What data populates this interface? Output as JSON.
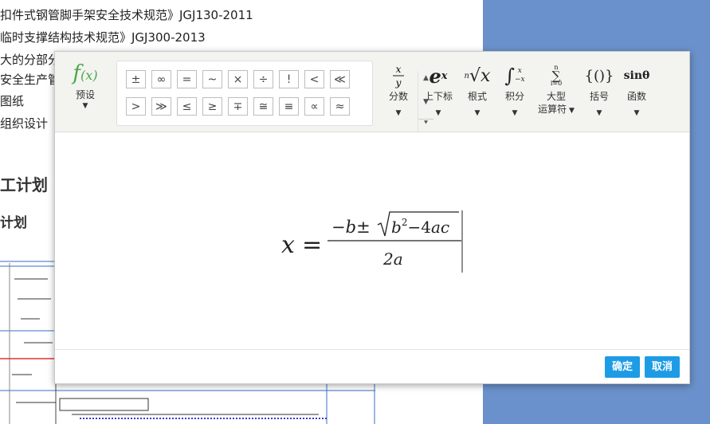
{
  "document": {
    "lines": [
      "扣件式钢管脚手架安全技术规范》JGJ130-2011",
      "临时支撑结构技术规范》JGJ300-2013",
      "大的分部分",
      "安全生产管",
      "图纸",
      "组织设计"
    ],
    "heading1": "工计划",
    "heading2": "计划"
  },
  "editor": {
    "preset": {
      "icon": "f(x)",
      "label": "预设"
    },
    "symbols_row1": [
      "±",
      "∞",
      "=",
      "~",
      "×",
      "÷",
      "!",
      "<",
      "≪"
    ],
    "symbols_row2": [
      ">",
      "≫",
      "≤",
      "≥",
      "∓",
      "≅",
      "≡",
      "∝",
      "≈"
    ],
    "tools": [
      {
        "icon": "x/y",
        "label": "分数"
      },
      {
        "icon": "eˣ",
        "label": "上下标"
      },
      {
        "icon": "ⁿ√x",
        "label": "根式"
      },
      {
        "icon": "∫",
        "label": "积分"
      },
      {
        "icon": "Σ",
        "label": "大型",
        "label2": "运算符"
      },
      {
        "icon": "{()}",
        "label": "括号"
      },
      {
        "icon": "sinθ",
        "label": "函数"
      }
    ],
    "formula": {
      "lhs": "x",
      "numerator": "−b±√(b²−4ac)",
      "denominator": "2a"
    },
    "buttons": {
      "ok": "确定",
      "cancel": "取消"
    }
  },
  "colors": {
    "accent": "#1d9ce5",
    "preset_icon": "#4aa64a",
    "background": "#6a91cb"
  }
}
